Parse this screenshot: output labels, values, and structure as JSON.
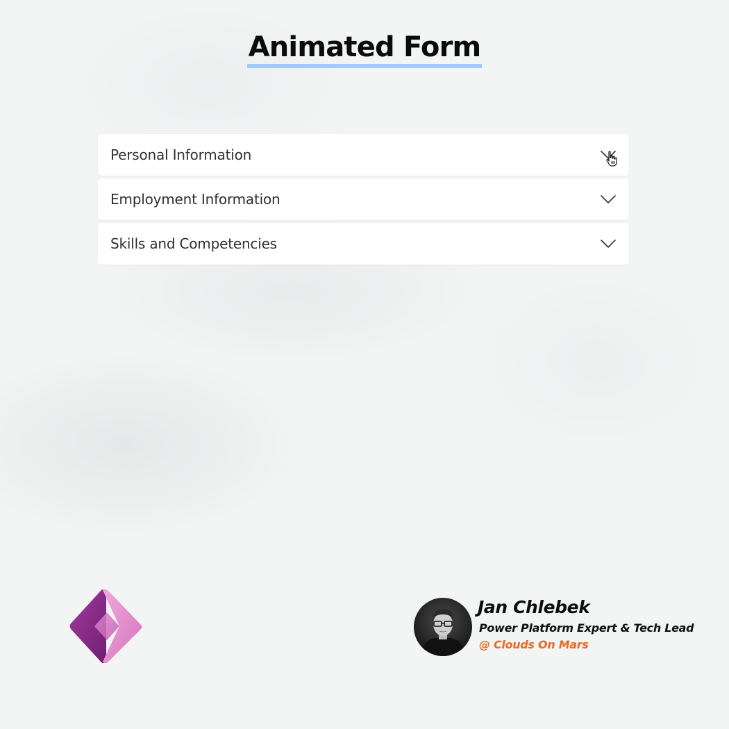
{
  "page": {
    "title": "Animated Form"
  },
  "accordion": {
    "sections": [
      {
        "label": "Personal Information",
        "icon": "chevron-down-icon"
      },
      {
        "label": "Employment Information",
        "icon": "chevron-down-icon"
      },
      {
        "label": "Skills and Competencies",
        "icon": "chevron-down-icon"
      }
    ]
  },
  "author": {
    "name": "Jan Chlebek",
    "role": "Power Platform Expert & Tech Lead",
    "company": "@ Clouds On Mars"
  },
  "logo": {
    "icon": "power-apps-logo-icon"
  },
  "colors": {
    "title_underline": "#9fcdf7",
    "company_accent": "#ec6a23",
    "logo_dark": "#8b2a8c",
    "logo_light": "#e48dcc",
    "background": "#f3f4f4"
  }
}
